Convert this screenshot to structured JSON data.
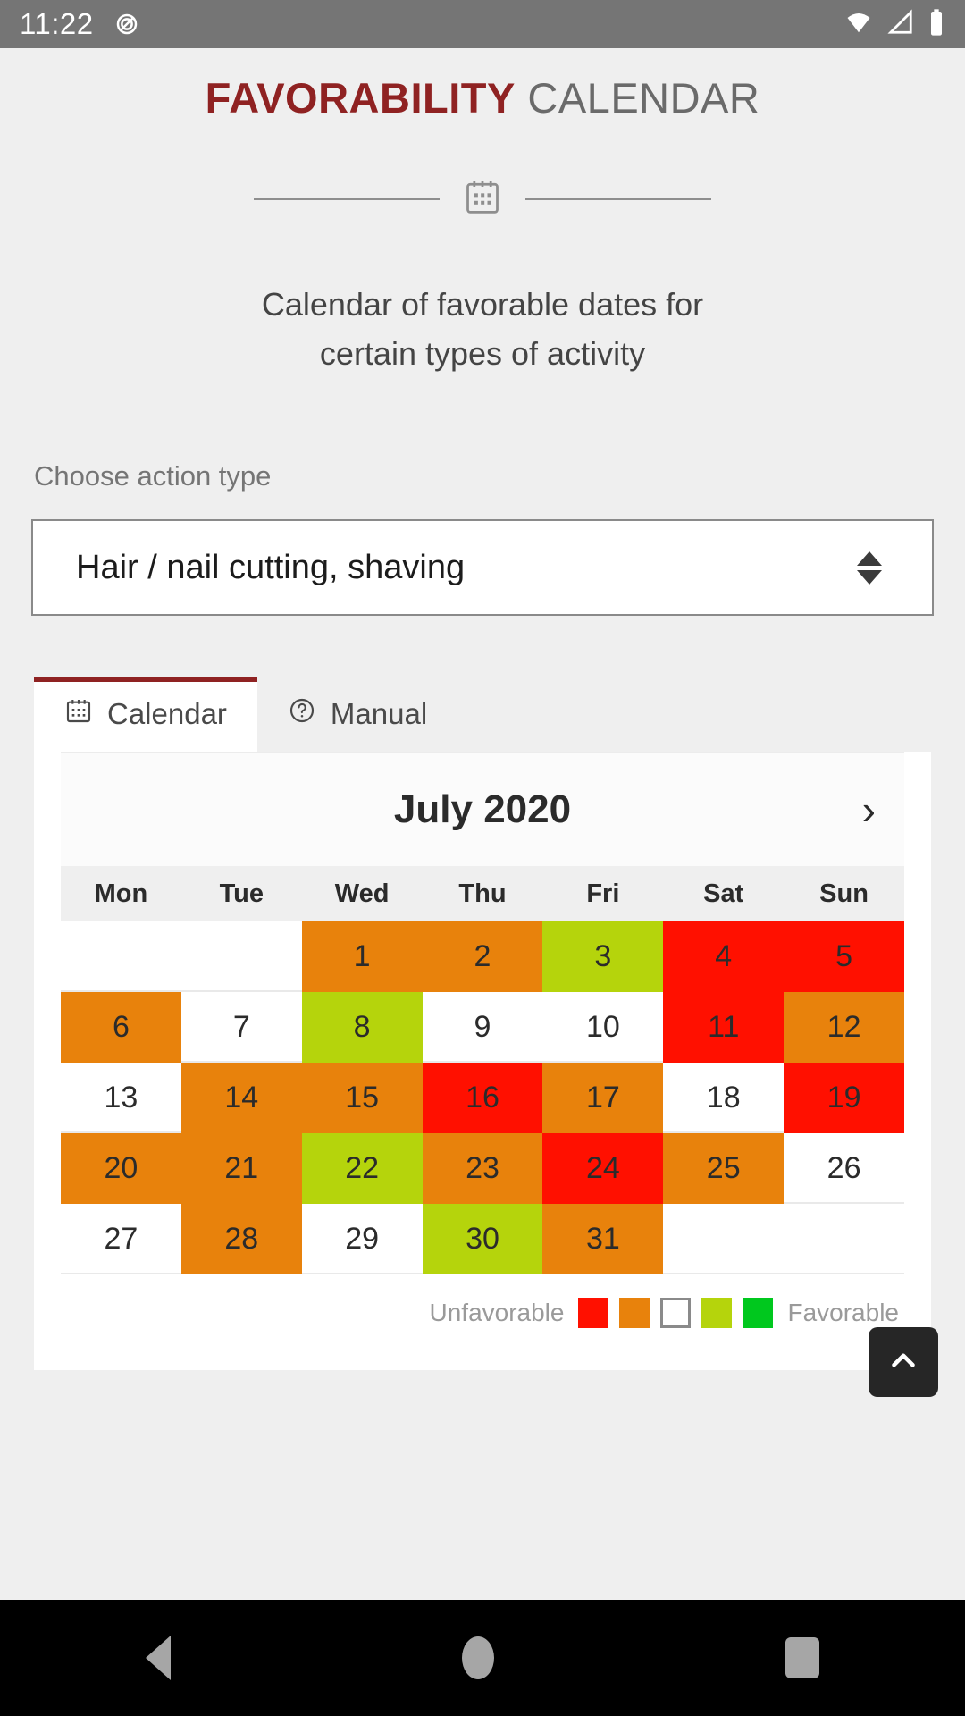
{
  "status_bar": {
    "time": "11:22",
    "icons": [
      "mute-icon",
      "wifi-icon",
      "signal-icon",
      "battery-icon"
    ]
  },
  "header": {
    "title_brand": "FAVORABILITY",
    "title_rest": " CALENDAR",
    "divider_icon": "calendar-icon",
    "intro_line1": "Calendar of favorable dates for",
    "intro_line2": "certain types of activity"
  },
  "action_type": {
    "label": "Choose action type",
    "selected": "Hair / nail cutting, shaving",
    "spinner_icon": "up-down-arrow-icon"
  },
  "tabs": [
    {
      "label": "Calendar",
      "icon": "calendar-icon",
      "active": true
    },
    {
      "label": "Manual",
      "icon": "question-circle-icon",
      "active": false
    }
  ],
  "calendar": {
    "month_title": "July 2020",
    "next_label": "›",
    "weekdays": [
      "Mon",
      "Tue",
      "Wed",
      "Thu",
      "Fri",
      "Sat",
      "Sun"
    ],
    "weeks": [
      [
        {
          "day": "",
          "level": "none"
        },
        {
          "day": "",
          "level": "none"
        },
        {
          "day": "1",
          "level": "orange"
        },
        {
          "day": "2",
          "level": "orange"
        },
        {
          "day": "3",
          "level": "lime"
        },
        {
          "day": "4",
          "level": "red"
        },
        {
          "day": "5",
          "level": "red"
        }
      ],
      [
        {
          "day": "6",
          "level": "orange"
        },
        {
          "day": "7",
          "level": "none"
        },
        {
          "day": "8",
          "level": "lime"
        },
        {
          "day": "9",
          "level": "none"
        },
        {
          "day": "10",
          "level": "none"
        },
        {
          "day": "11",
          "level": "red"
        },
        {
          "day": "12",
          "level": "orange"
        }
      ],
      [
        {
          "day": "13",
          "level": "none"
        },
        {
          "day": "14",
          "level": "orange"
        },
        {
          "day": "15",
          "level": "orange"
        },
        {
          "day": "16",
          "level": "red"
        },
        {
          "day": "17",
          "level": "orange"
        },
        {
          "day": "18",
          "level": "none"
        },
        {
          "day": "19",
          "level": "red"
        }
      ],
      [
        {
          "day": "20",
          "level": "orange"
        },
        {
          "day": "21",
          "level": "orange"
        },
        {
          "day": "22",
          "level": "lime"
        },
        {
          "day": "23",
          "level": "orange"
        },
        {
          "day": "24",
          "level": "red"
        },
        {
          "day": "25",
          "level": "orange"
        },
        {
          "day": "26",
          "level": "none"
        }
      ],
      [
        {
          "day": "27",
          "level": "none"
        },
        {
          "day": "28",
          "level": "orange"
        },
        {
          "day": "29",
          "level": "none"
        },
        {
          "day": "30",
          "level": "lime"
        },
        {
          "day": "31",
          "level": "orange"
        },
        {
          "day": "",
          "level": "none"
        },
        {
          "day": "",
          "level": "none"
        }
      ]
    ]
  },
  "legend": {
    "left_label": "Unfavorable",
    "right_label": "Favorable",
    "swatches": [
      "red",
      "orange",
      "none",
      "lime",
      "green"
    ]
  },
  "colors": {
    "red": "#ff1000",
    "orange": "#e8820c",
    "lime": "#b5d40c",
    "green": "#00c81e",
    "brand": "#8f2222",
    "page_bg": "#efefef",
    "status_bar": "#757575"
  },
  "scroll_top_button": {
    "icon": "chevron-up-icon"
  },
  "nav_bar": {
    "back": "back-icon",
    "home": "home-icon",
    "recents": "recents-icon"
  }
}
